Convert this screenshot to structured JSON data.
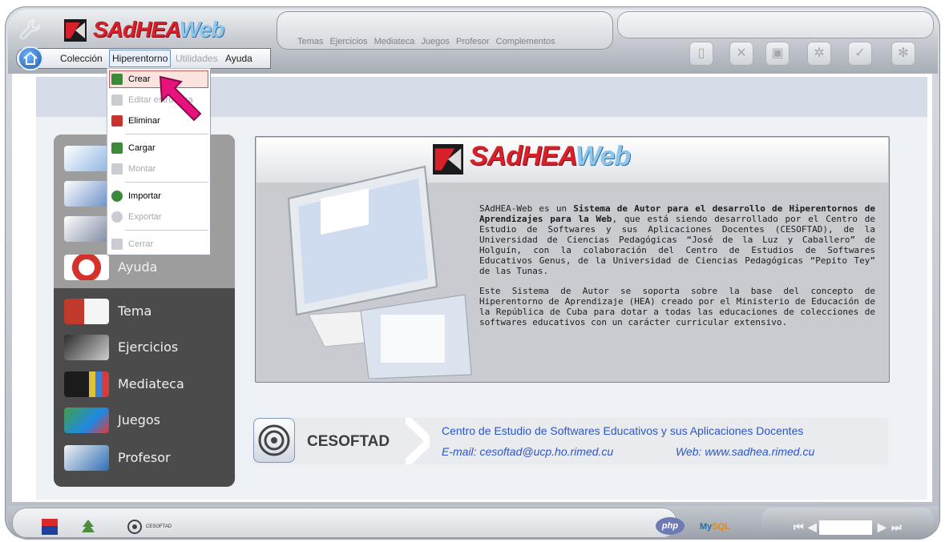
{
  "app": {
    "logo_part1": "SAdHEA",
    "logo_part2": "Web"
  },
  "menu": {
    "items": [
      {
        "label": "Colección",
        "enabled": true
      },
      {
        "label": "Hiperentorno",
        "enabled": true,
        "active": true
      },
      {
        "label": "Utilidades",
        "enabled": false
      },
      {
        "label": "Ayuda",
        "enabled": true
      }
    ]
  },
  "navlinks": [
    "Temas",
    "Ejercicios",
    "Mediateca",
    "Juegos",
    "Profesor",
    "Complementos"
  ],
  "toolbar": {
    "icons": [
      "new-document-icon",
      "delete-document-icon",
      "save-icon",
      "settings-icon",
      "check-icon",
      "tool-icon"
    ]
  },
  "dropdown": {
    "items": [
      {
        "label": "Crear",
        "enabled": true,
        "selected": true,
        "icon_color": "#3a8a3a"
      },
      {
        "label": "Editar estructura",
        "enabled": false,
        "icon_color": "#c9cdd2"
      },
      {
        "label": "Eliminar",
        "enabled": true,
        "icon_color": "#c8342d"
      },
      {
        "label": "Cargar",
        "enabled": true,
        "icon_color": "#3a8a3a"
      },
      {
        "label": "Montar",
        "enabled": false,
        "icon_color": "#c9cdd2"
      },
      {
        "label": "Importar",
        "enabled": true,
        "icon_color": "#3a8a3a"
      },
      {
        "label": "Exportar",
        "enabled": false,
        "icon_color": "#c9cdd2"
      },
      {
        "label": "Cerrar",
        "enabled": false,
        "icon_color": "#c9cdd2"
      }
    ]
  },
  "sidebar": {
    "top_items": [
      {
        "label": "",
        "icon": "collection-icon"
      },
      {
        "label": "",
        "icon": "window-icon"
      },
      {
        "label": "",
        "icon": "tools-icon"
      },
      {
        "label": "Ayuda",
        "icon": "lifebuoy-icon"
      }
    ],
    "items": [
      {
        "label": "Tema",
        "icon": "book-icon"
      },
      {
        "label": "Ejercicios",
        "icon": "exercise-icon"
      },
      {
        "label": "Mediateca",
        "icon": "media-icon"
      },
      {
        "label": "Juegos",
        "icon": "puzzle-icon"
      },
      {
        "label": "Profesor",
        "icon": "teacher-icon"
      }
    ]
  },
  "info": {
    "para1_plain1": "SAdHEA-Web es un ",
    "para1_bold": "Sistema de Autor para el desarrollo de Hiperentornos de Aprendizajes para la Web",
    "para1_plain2": ", que está siendo desarrollado por el Centro de Estudio de Softwares y sus Aplicaciones Docentes (CESOFTAD), de la Universidad de Ciencias Pedagógicas “José de la Luz y Caballero” de Holguín, con la colaboración del Centro de Estudios de Softwares Educativos Genus, de la Universidad de Ciencias Pedagógicas “Pepito Tey” de las Tunas.",
    "para2": "Este Sistema de  Autor se soporta sobre la base del concepto de Hiperentorno de Aprendizaje (HEA) creado por el Ministerio de Educación de la República de Cuba para dotar a todas las educaciones de colecciones de softwares educativos con un carácter curricular extensivo."
  },
  "cesoftad": {
    "name": "CESOFTAD",
    "full_name": "Centro de Estudio de Softwares Educativos y sus Aplicaciones Docentes",
    "email": "E-mail: cesoftad@ucp.ho.rimed.cu",
    "web": "Web: www.sadhea.rimed.cu"
  },
  "bottom": {
    "ces_label": "CESOFTAD",
    "php_label": "php",
    "mysql_part1": "My",
    "mysql_part2": "SQL",
    "pager_first": "⏮",
    "pager_prev": "◀",
    "pager_next": "▶",
    "pager_last": "⏭"
  }
}
